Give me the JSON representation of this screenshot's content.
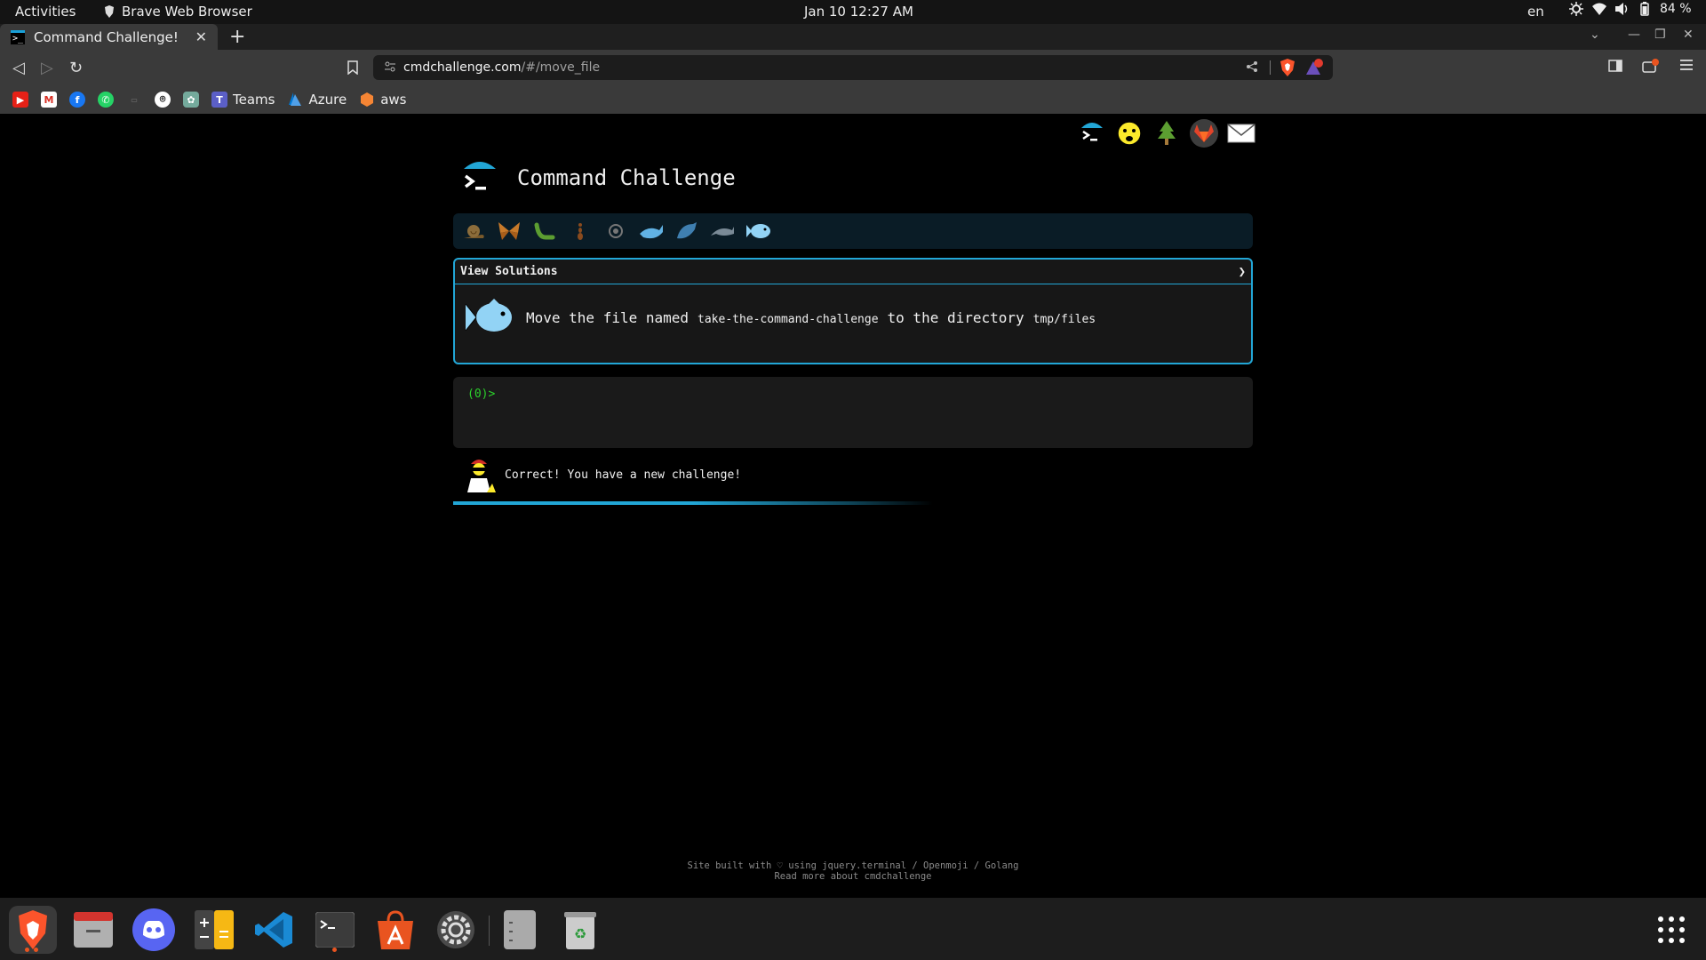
{
  "system": {
    "activities": "Activities",
    "app_name": "Brave Web Browser",
    "clock": "Jan 10  12:27 AM",
    "language": "en",
    "battery": "84 %"
  },
  "browser": {
    "tab_title": "Command Challenge!",
    "url_host": "cmdchallenge.com",
    "url_path": "/#/move_file",
    "bookmarks": [
      "Teams",
      "Azure",
      "aws"
    ]
  },
  "page": {
    "site_title": "Command Challenge",
    "challenge": {
      "header": "View Solutions",
      "chevron": "❯",
      "text_before": "Move the file named",
      "file_name": "take-the-command-challenge",
      "text_middle": "to the directory",
      "dir_name": "tmp/files"
    },
    "prompt": "(0)>",
    "feedback": "Correct! You have a new challenge!",
    "progress_fraction": 0.45,
    "footer_line1": "Site built with ♡ using jquery.terminal / Openmoji / Golang",
    "footer_line2": "Read more about cmdchallenge"
  },
  "colors": {
    "accent": "#22a6d6",
    "prompt_green": "#2bd12b",
    "brave_orange": "#fb542b"
  }
}
